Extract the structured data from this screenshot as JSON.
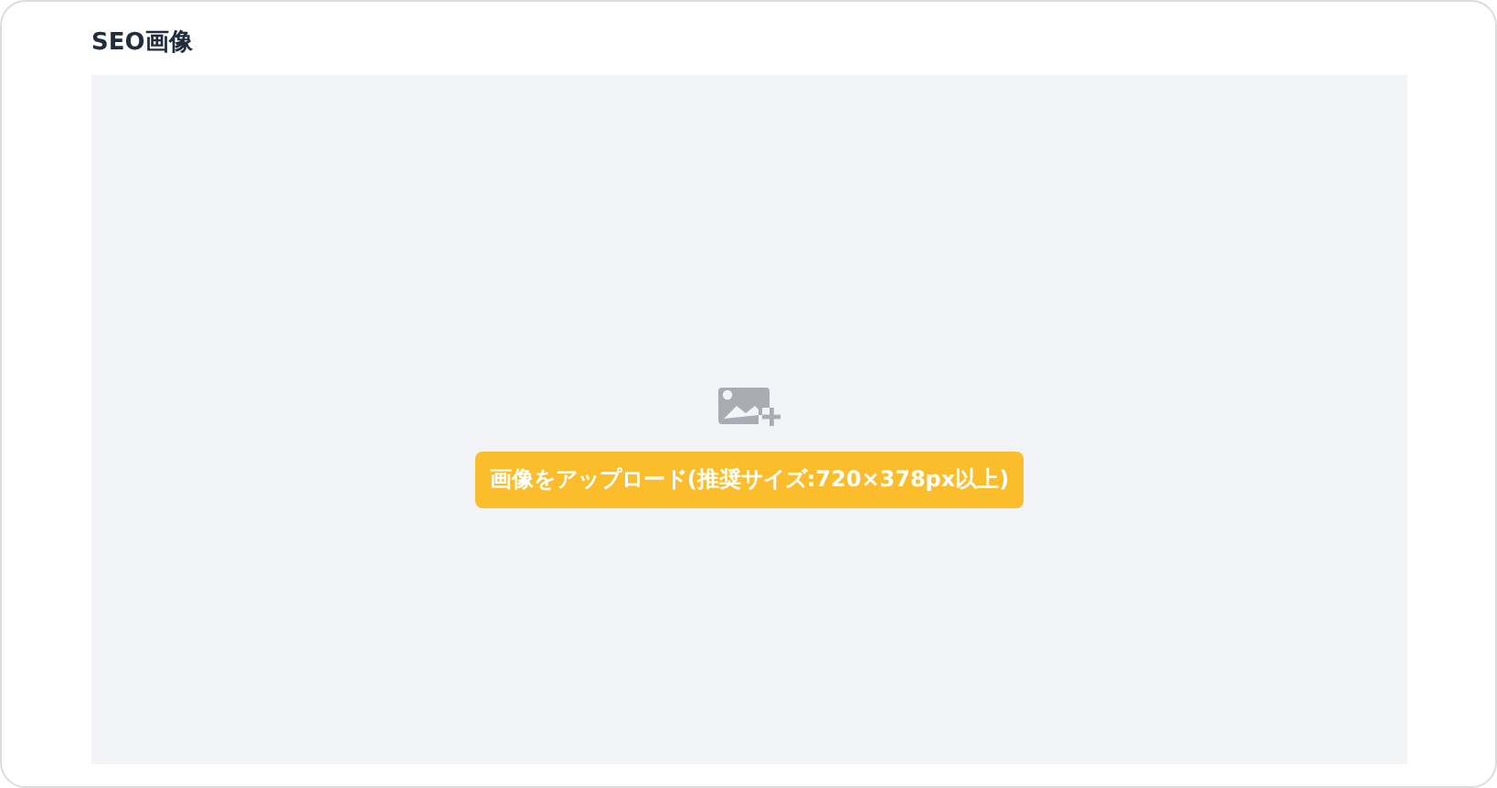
{
  "section": {
    "title": "SEO画像"
  },
  "upload": {
    "button": "画像をアップロード(推奨サイズ:720×378px以上)"
  }
}
